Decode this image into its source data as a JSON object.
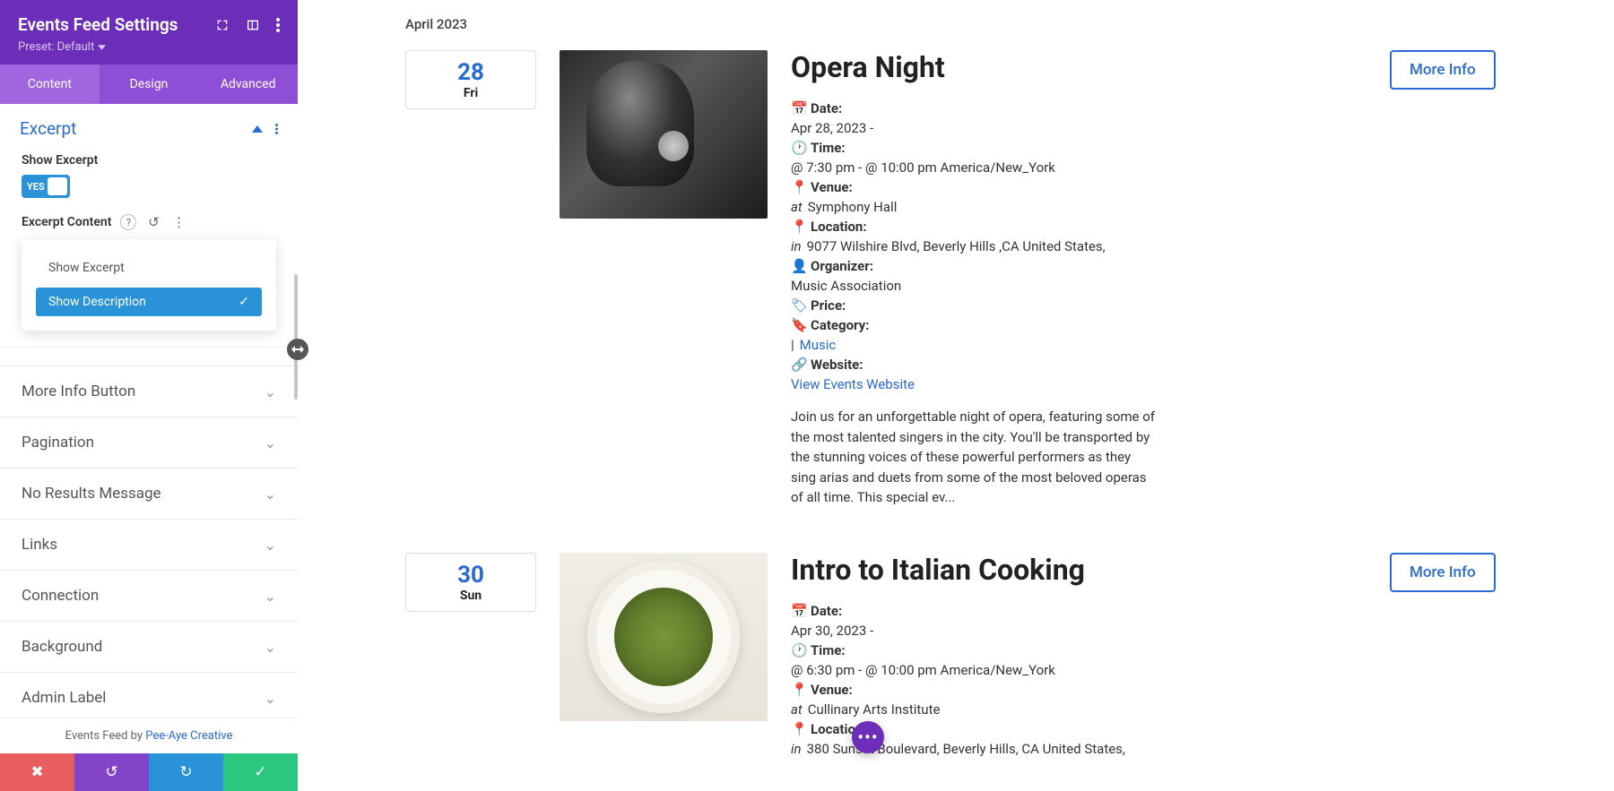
{
  "sidebar": {
    "title": "Events Feed Settings",
    "preset": "Preset: Default",
    "tabs": {
      "content": "Content",
      "design": "Design",
      "advanced": "Advanced"
    },
    "excerpt_section": {
      "title": "Excerpt",
      "show_excerpt_label": "Show Excerpt",
      "toggle_text": "YES",
      "excerpt_content_label": "Excerpt Content",
      "options": {
        "show_excerpt": "Show Excerpt",
        "show_description": "Show Description"
      }
    },
    "collapsed": {
      "more_info": "More Info Button",
      "pagination": "Pagination",
      "no_results": "No Results Message",
      "links": "Links",
      "connection": "Connection",
      "background": "Background",
      "admin_label": "Admin Label"
    },
    "footer_by": "Events Feed by ",
    "footer_link": "Pee-Aye Creative"
  },
  "preview": {
    "month": "April 2023",
    "events": [
      {
        "date_num": "28",
        "date_day": "Fri",
        "title": "Opera Night",
        "date_label": "Date:",
        "date_value": "Apr 28, 2023 -",
        "time_label": "Time:",
        "time_value": "@ 7:30 pm - @ 10:00 pm America/New_York",
        "venue_label": "Venue:",
        "venue_prefix": "at",
        "venue_value": "Symphony Hall",
        "location_label": "Location:",
        "location_prefix": "in",
        "location_value": "9077 Wilshire Blvd, Beverly Hills ,CA United States,",
        "organizer_label": "Organizer:",
        "organizer_value": "Music Association",
        "price_label": "Price:",
        "category_label": "Category:",
        "category_sep": "| ",
        "category_value": "Music",
        "website_label": "Website:",
        "website_link": "View Events Website",
        "excerpt": "Join us for an unforgettable night of opera, featuring some of the most talented singers in the city. You'll be transported by the stunning voices of these powerful performers as they sing arias and duets from some of the most beloved operas of all time. This special ev...",
        "more": "More Info"
      },
      {
        "date_num": "30",
        "date_day": "Sun",
        "title": "Intro to Italian Cooking",
        "date_label": "Date:",
        "date_value": "Apr 30, 2023 -",
        "time_label": "Time:",
        "time_value": "@ 6:30 pm - @ 10:00 pm America/New_York",
        "venue_label": "Venue:",
        "venue_prefix": "at",
        "venue_value": "Cullinary Arts Institute",
        "location_label": "Location:",
        "location_prefix": "in",
        "location_value": "380 Sunset Boulevard, Beverly Hills, CA United States,",
        "more": "More Info"
      }
    ]
  }
}
